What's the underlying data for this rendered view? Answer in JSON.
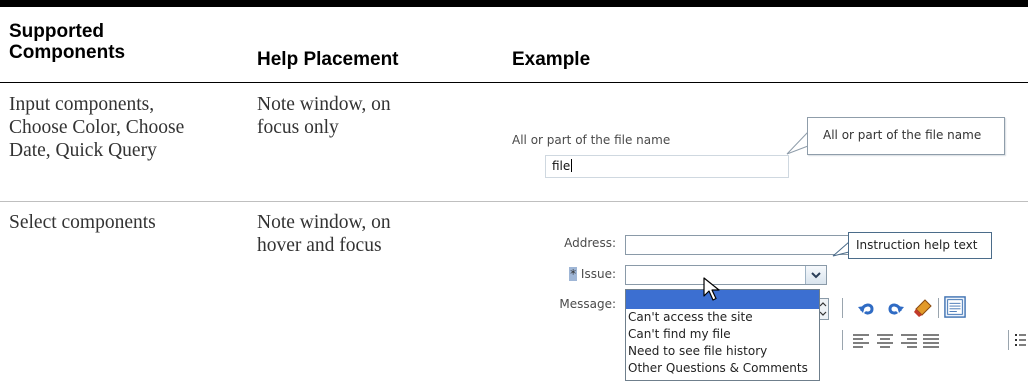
{
  "table": {
    "headers": {
      "col1_line1": "Supported",
      "col1_line2": "Components",
      "col2": "Help Placement",
      "col3": "Example"
    },
    "rows": [
      {
        "components": [
          "Input components,",
          "Choose Color, Choose",
          "Date, Quick Query"
        ],
        "placement": [
          "Note window, on",
          "focus only"
        ]
      },
      {
        "components": [
          "Select components"
        ],
        "placement": [
          "Note window, on",
          "hover and focus"
        ]
      }
    ]
  },
  "example1": {
    "field_label": "All or part of the file name",
    "input_value": "file",
    "note_text": "All or part of the file name"
  },
  "example2": {
    "address_label": "Address:",
    "required_marker": "*",
    "issue_label": "Issue:",
    "message_label": "Message:",
    "note_text": "Instruction help text",
    "dropdown_options": [
      "",
      "Can't access the site",
      "Can't find my file",
      "Need to see file history",
      "Other Questions & Comments"
    ]
  },
  "colors": {
    "dropdown_highlight": "#3c6fd1",
    "note_border": "#4b6c8a",
    "required_highlight": "#9fb6d6"
  }
}
